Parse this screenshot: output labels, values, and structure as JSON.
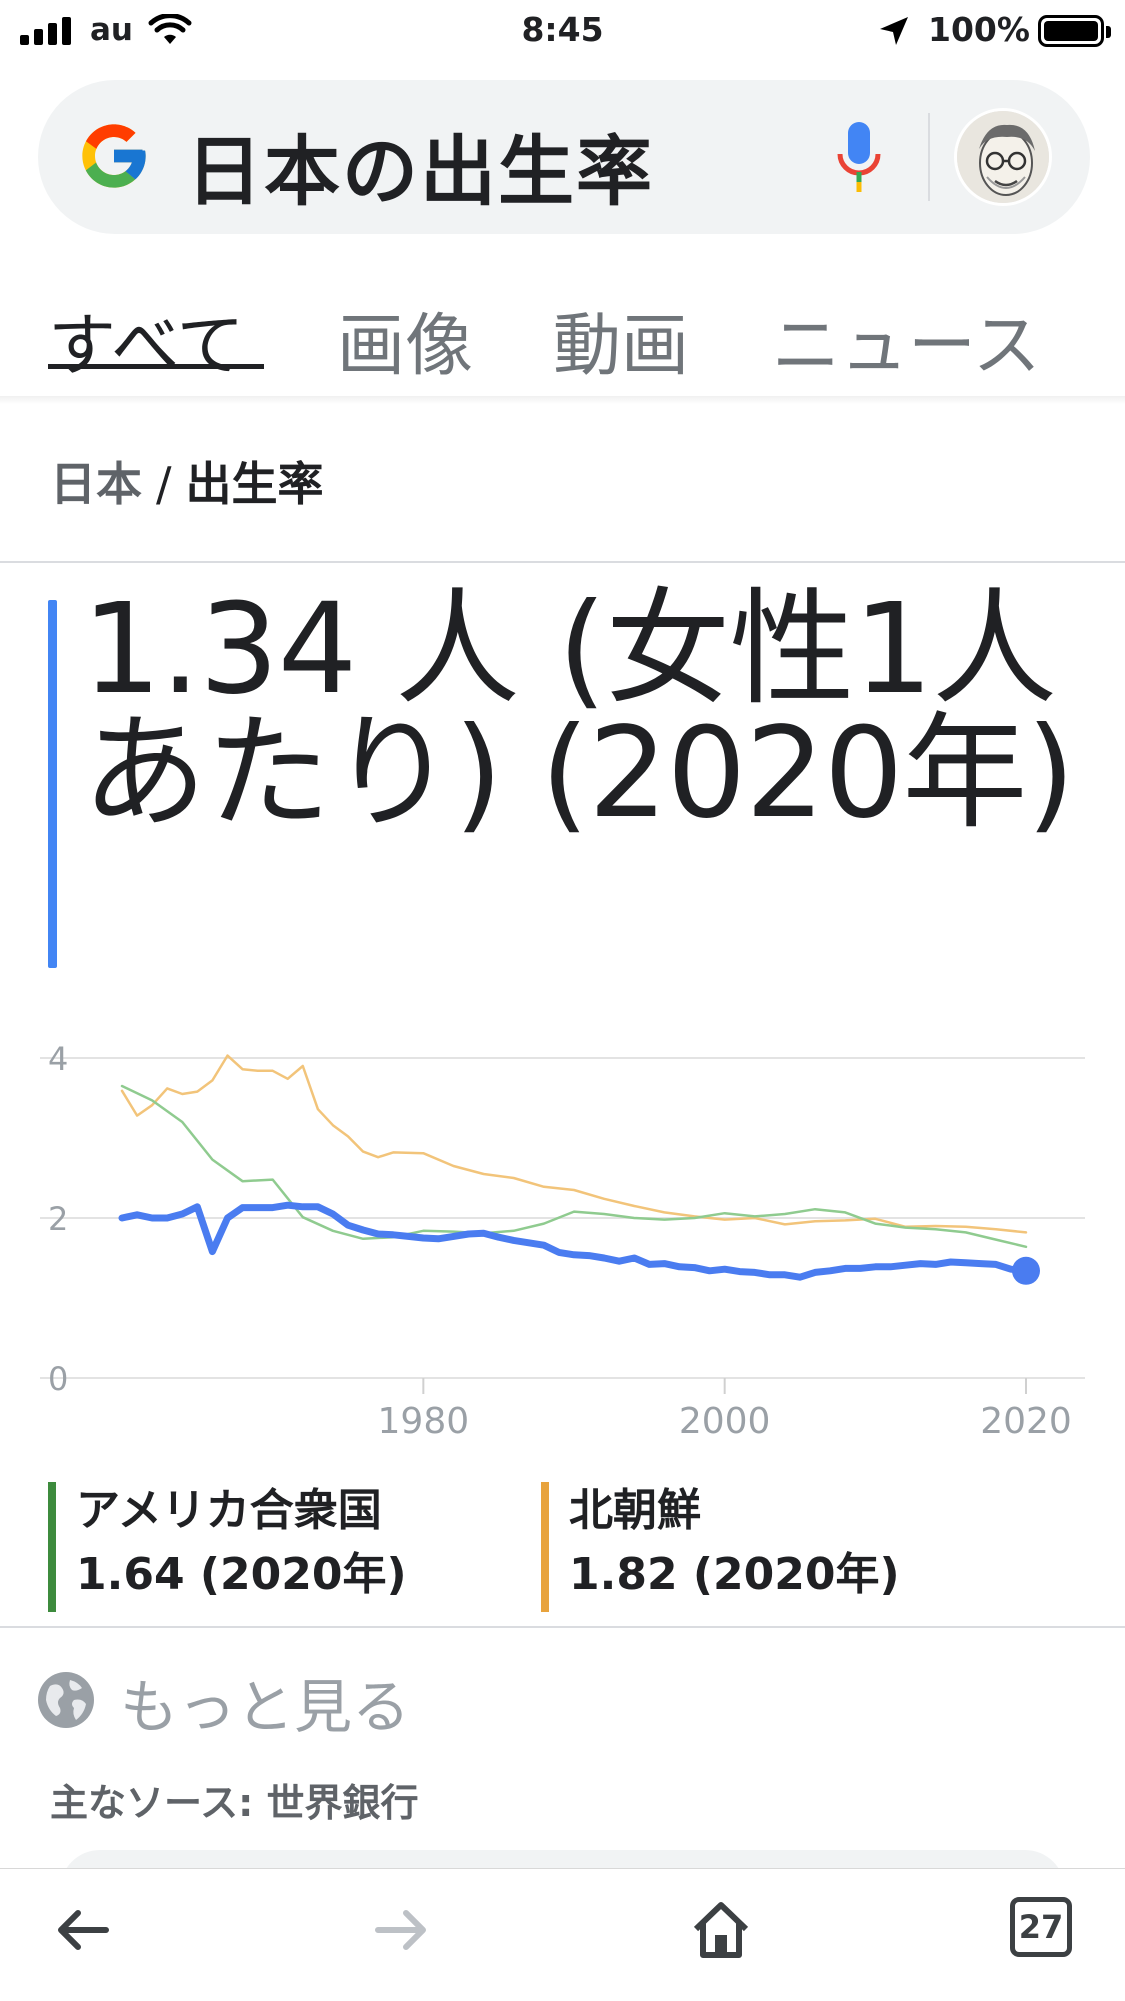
{
  "status_bar": {
    "carrier": "au",
    "time": "8:45",
    "battery_percent": "100%",
    "icons": [
      "signal-icon",
      "wifi-icon",
      "location-arrow-icon",
      "battery-icon"
    ]
  },
  "search": {
    "query": "日本の出生率",
    "icons": [
      "google-g-icon",
      "microphone-icon",
      "avatar"
    ]
  },
  "tabs": [
    {
      "label": "すべて",
      "active": true
    },
    {
      "label": "画像",
      "active": false
    },
    {
      "label": "動画",
      "active": false
    },
    {
      "label": "ニュース",
      "active": false
    }
  ],
  "breadcrumb": {
    "parent": "日本",
    "separator": "/",
    "current": "出生率"
  },
  "answer": {
    "value_text": "1.34 人 (女性1人あたり) (2020年)"
  },
  "chart_data": {
    "type": "line",
    "ylim": [
      0,
      4
    ],
    "xlim": [
      1960,
      2020
    ],
    "grid": true,
    "y_ticks": [
      "4",
      "2",
      "0"
    ],
    "x_ticks": [
      "1980",
      "2000",
      "2020"
    ],
    "series": [
      {
        "name": "日本",
        "color": "#4a7cf0",
        "x": [
          1960,
          1961,
          1962,
          1963,
          1964,
          1965,
          1966,
          1967,
          1968,
          1969,
          1970,
          1971,
          1972,
          1973,
          1974,
          1975,
          1976,
          1977,
          1978,
          1979,
          1980,
          1981,
          1982,
          1983,
          1984,
          1985,
          1986,
          1987,
          1988,
          1989,
          1990,
          1991,
          1992,
          1993,
          1994,
          1995,
          1996,
          1997,
          1998,
          1999,
          2000,
          2001,
          2002,
          2003,
          2004,
          2005,
          2006,
          2007,
          2008,
          2009,
          2010,
          2011,
          2012,
          2013,
          2014,
          2015,
          2016,
          2017,
          2018,
          2019,
          2020
        ],
        "values": [
          2.0,
          2.04,
          2.0,
          2.0,
          2.05,
          2.14,
          1.58,
          2.0,
          2.13,
          2.13,
          2.13,
          2.16,
          2.14,
          2.14,
          2.05,
          1.91,
          1.85,
          1.8,
          1.79,
          1.77,
          1.75,
          1.74,
          1.77,
          1.8,
          1.81,
          1.76,
          1.72,
          1.69,
          1.66,
          1.57,
          1.54,
          1.53,
          1.5,
          1.46,
          1.5,
          1.42,
          1.43,
          1.39,
          1.38,
          1.34,
          1.36,
          1.33,
          1.32,
          1.29,
          1.29,
          1.26,
          1.32,
          1.34,
          1.37,
          1.37,
          1.39,
          1.39,
          1.41,
          1.43,
          1.42,
          1.45,
          1.44,
          1.43,
          1.42,
          1.36,
          1.34
        ],
        "end_marker": true
      },
      {
        "name": "アメリカ合衆国",
        "color": "#8fcb8f",
        "x": [
          1960,
          1962,
          1964,
          1966,
          1968,
          1970,
          1972,
          1974,
          1976,
          1978,
          1980,
          1982,
          1984,
          1986,
          1988,
          1990,
          1992,
          1994,
          1996,
          1998,
          2000,
          2002,
          2004,
          2006,
          2008,
          2010,
          2012,
          2014,
          2016,
          2018,
          2020
        ],
        "values": [
          3.65,
          3.47,
          3.2,
          2.73,
          2.46,
          2.48,
          2.01,
          1.84,
          1.74,
          1.76,
          1.84,
          1.83,
          1.81,
          1.84,
          1.93,
          2.08,
          2.05,
          2.0,
          1.98,
          2.0,
          2.06,
          2.02,
          2.05,
          2.11,
          2.07,
          1.93,
          1.88,
          1.86,
          1.82,
          1.73,
          1.64
        ]
      },
      {
        "name": "北朝鮮",
        "color": "#f2c47a",
        "x": [
          1960,
          1961,
          1962,
          1963,
          1964,
          1965,
          1966,
          1967,
          1968,
          1969,
          1970,
          1971,
          1972,
          1973,
          1974,
          1975,
          1976,
          1977,
          1978,
          1980,
          1982,
          1984,
          1986,
          1988,
          1990,
          1992,
          1994,
          1996,
          1998,
          2000,
          2002,
          2004,
          2006,
          2008,
          2010,
          2012,
          2014,
          2016,
          2018,
          2020
        ],
        "values": [
          3.59,
          3.28,
          3.41,
          3.62,
          3.55,
          3.58,
          3.72,
          4.03,
          3.86,
          3.84,
          3.84,
          3.74,
          3.9,
          3.36,
          3.16,
          3.02,
          2.83,
          2.76,
          2.82,
          2.81,
          2.65,
          2.55,
          2.5,
          2.39,
          2.35,
          2.24,
          2.15,
          2.07,
          2.02,
          1.98,
          2.0,
          1.92,
          1.96,
          1.97,
          1.99,
          1.89,
          1.9,
          1.89,
          1.86,
          1.82
        ]
      }
    ]
  },
  "legend": [
    {
      "name": "アメリカ合衆国",
      "value": "1.64 (2020年)",
      "color": "#3d8b3d"
    },
    {
      "name": "北朝鮮",
      "value": "1.82 (2020年)",
      "color": "#e8a33d"
    }
  ],
  "more": {
    "label": "もっと見る"
  },
  "source": {
    "text": "主なソース: 世界銀行"
  },
  "toolbar": {
    "tabs_count": "27",
    "icons": [
      "back-arrow-icon",
      "forward-arrow-icon",
      "home-icon",
      "tabs-icon"
    ]
  }
}
